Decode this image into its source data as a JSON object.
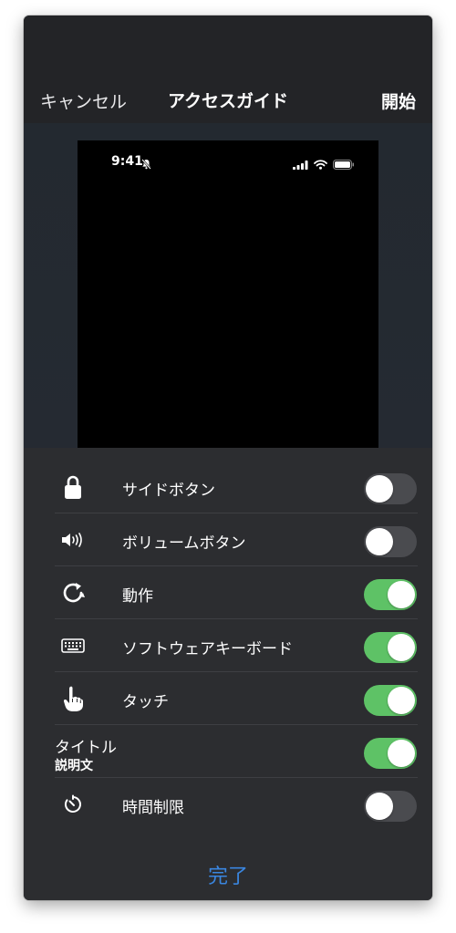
{
  "navbar": {
    "cancel_label": "キャンセル",
    "title": "アクセスガイド",
    "start_label": "開始"
  },
  "preview": {
    "status_time": "9:41"
  },
  "options": {
    "items": [
      {
        "label": "サイドボタン",
        "icon": "lock-icon",
        "enabled": false
      },
      {
        "label": "ボリュームボタン",
        "icon": "speaker-icon",
        "enabled": false
      },
      {
        "label": "動作",
        "icon": "rotate-icon",
        "enabled": true
      },
      {
        "label": "ソフトウェアキーボード",
        "icon": "keyboard-icon",
        "enabled": true
      },
      {
        "label": "タッチ",
        "icon": "hand-pointer-icon",
        "enabled": true
      },
      {
        "label": "タイトル",
        "sublabel": "説明文",
        "enabled": true
      },
      {
        "label": "時間制限",
        "icon": "timer-icon",
        "enabled": false
      }
    ]
  },
  "footer": {
    "done_label": "完了"
  },
  "colors": {
    "toggle_on": "#5ec266",
    "toggle_off": "#4a4b4f",
    "accent": "#3a86e0"
  }
}
